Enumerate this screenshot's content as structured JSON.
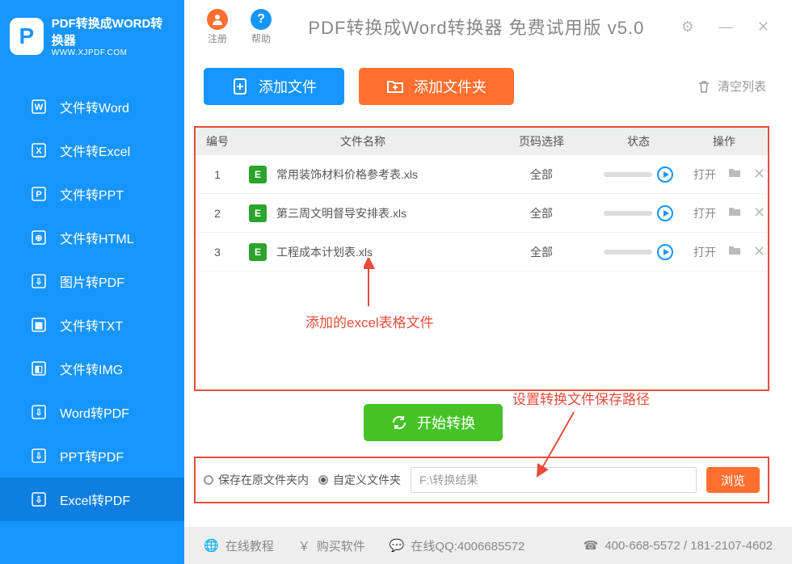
{
  "logo": {
    "title": "PDF转换成WORD转换器",
    "sub": "WWW.XJPDF.COM",
    "letter": "P"
  },
  "nav": [
    {
      "label": "文件转Word",
      "icon": "W"
    },
    {
      "label": "文件转Excel",
      "icon": "X"
    },
    {
      "label": "文件转PPT",
      "icon": "P"
    },
    {
      "label": "文件转HTML",
      "icon": "⊕"
    },
    {
      "label": "图片转PDF",
      "icon": "⇩"
    },
    {
      "label": "文件转TXT",
      "icon": "▦"
    },
    {
      "label": "文件转IMG",
      "icon": "◧"
    },
    {
      "label": "Word转PDF",
      "icon": "⇩"
    },
    {
      "label": "PPT转PDF",
      "icon": "⇩"
    },
    {
      "label": "Excel转PDF",
      "icon": "⇩"
    }
  ],
  "nav_active_index": 9,
  "header": {
    "register": "注册",
    "help": "帮助",
    "title": "PDF转换成Word转换器 免费试用版 v5.0"
  },
  "toolbar": {
    "add_file": "添加文件",
    "add_folder": "添加文件夹",
    "clear_list": "清空列表"
  },
  "table": {
    "head": {
      "num": "编号",
      "name": "文件名称",
      "page": "页码选择",
      "stat": "状态",
      "op": "操作"
    },
    "rows": [
      {
        "num": "1",
        "name": "常用装饰材料价格参考表.xls",
        "page": "全部",
        "open": "打开"
      },
      {
        "num": "2",
        "name": "第三周文明督导安排表.xls",
        "page": "全部",
        "open": "打开"
      },
      {
        "num": "3",
        "name": "工程成本计划表.xls",
        "page": "全部",
        "open": "打开"
      }
    ]
  },
  "annotations": {
    "a1": "添加的excel表格文件",
    "a2": "设置转换文件保存路径"
  },
  "convert_button": "开始转换",
  "save": {
    "opt1": "保存在原文件夹内",
    "opt2": "自定义文件夹",
    "path": "F:\\转换结果",
    "browse": "浏览"
  },
  "footer": {
    "tutorial": "在线教程",
    "buy": "购买软件",
    "qq": "在线QQ:4006685572",
    "phone": "400-668-5572 / 181-2107-4602"
  }
}
